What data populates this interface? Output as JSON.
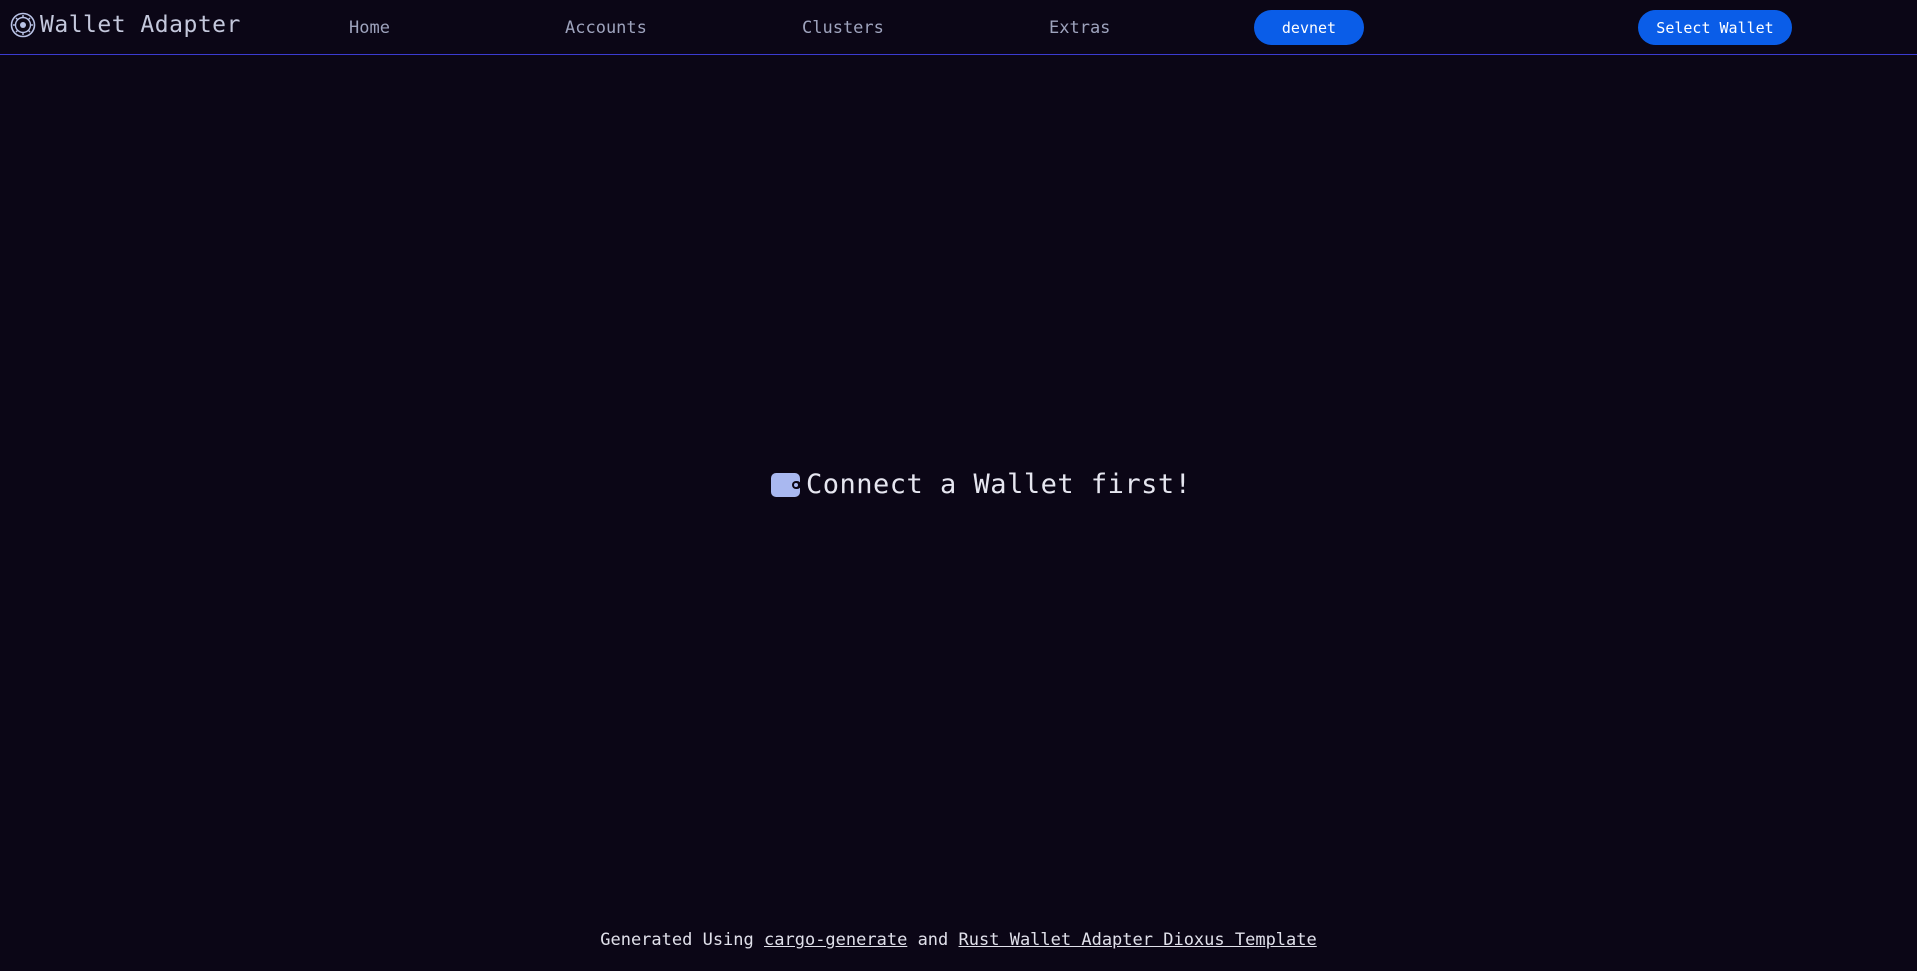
{
  "header": {
    "brand_title": "Wallet Adapter",
    "nav": {
      "home": "Home",
      "accounts": "Accounts",
      "clusters": "Clusters",
      "extras": "Extras"
    },
    "cluster_button": "devnet",
    "select_wallet_button": "Select Wallet"
  },
  "main": {
    "message": "Connect a Wallet first!"
  },
  "footer": {
    "prefix": "Generated Using",
    "link1": "cargo-generate",
    "conjunction": "and",
    "link2": "Rust Wallet Adapter Dioxus Template"
  },
  "colors": {
    "background": "#0b0616",
    "accent": "#0a5de8",
    "header_border": "#3b3bd0",
    "icon_fill": "#a9b8f0"
  },
  "icons": {
    "brand": "solana-gear-logo-icon",
    "wallet": "wallet-icon"
  }
}
